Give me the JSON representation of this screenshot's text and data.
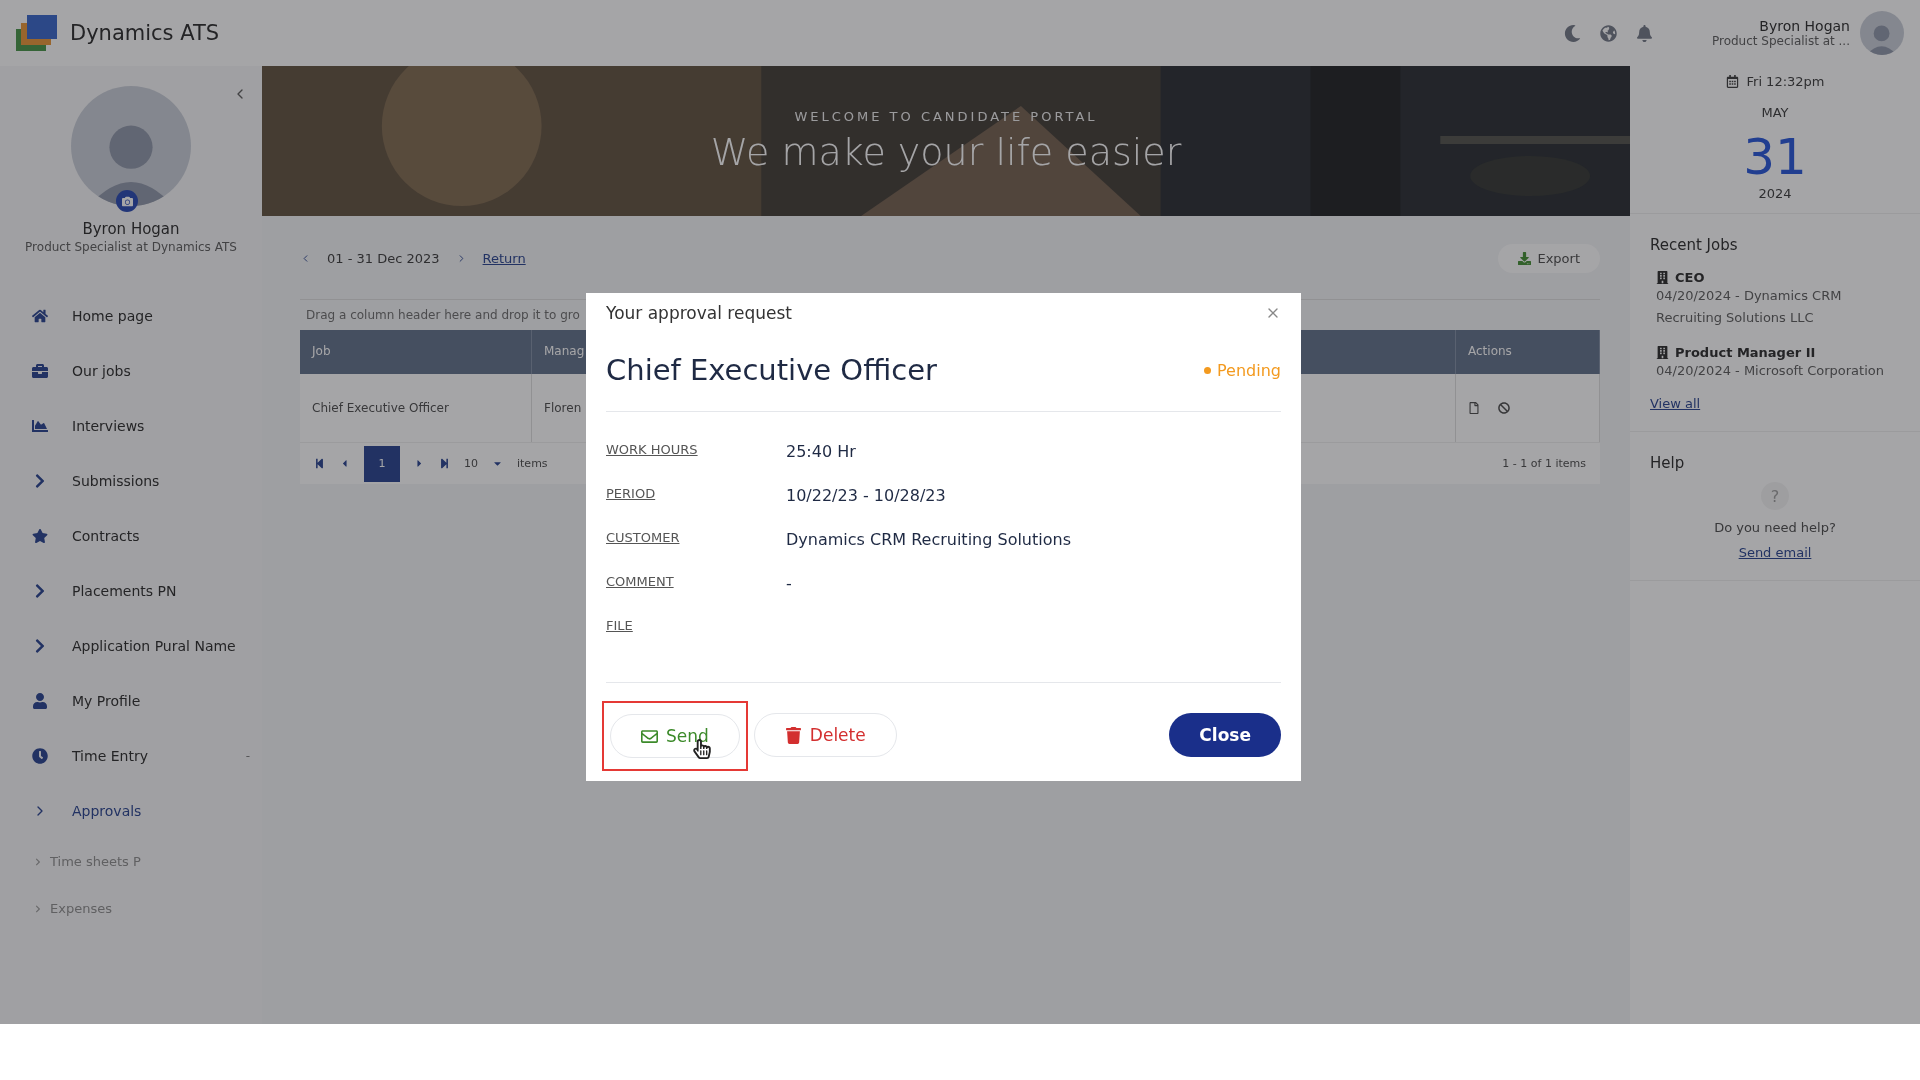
{
  "app": {
    "name": "Dynamics ATS"
  },
  "user": {
    "name": "Byron Hogan",
    "role_short": "Product Specialist at ..."
  },
  "profile": {
    "name": "Byron Hogan",
    "role": "Product Specialist at Dynamics ATS"
  },
  "nav": [
    {
      "label": "Home page",
      "kind": "home",
      "selected": false
    },
    {
      "label": "Our jobs",
      "kind": "jobs",
      "selected": false
    },
    {
      "label": "Interviews",
      "kind": "interviews",
      "selected": false
    },
    {
      "label": "Submissions",
      "kind": "group",
      "selected": false
    },
    {
      "label": "Contracts",
      "kind": "contracts",
      "selected": false
    },
    {
      "label": "Placements PN",
      "kind": "group",
      "selected": false
    },
    {
      "label": "Application Pural Name",
      "kind": "group",
      "selected": false
    },
    {
      "label": "My Profile",
      "kind": "profile",
      "selected": false
    },
    {
      "label": "Time Entry",
      "kind": "time",
      "selected": false,
      "trailing": "-"
    },
    {
      "label": "Approvals",
      "kind": "folder",
      "selected": true,
      "expanded": true,
      "children": [
        {
          "label": "Time sheets P"
        },
        {
          "label": "Expenses"
        }
      ]
    }
  ],
  "banner": {
    "kicker": "WELCOME TO CANDIDATE PORTAL",
    "headline": "We make your life easier"
  },
  "toolbar": {
    "range": "01 - 31 Dec 2023",
    "link": "Return",
    "export": "Export"
  },
  "grid": {
    "group_hint": "Drag a column header here and drop it to gro",
    "columns": [
      "Job",
      "Manag",
      "Actions"
    ],
    "rows": [
      [
        "Chief Executive Officer",
        "Floren"
      ]
    ],
    "pager": {
      "page": "1",
      "size": "10",
      "size_label": "items",
      "summary": "1 - 1 of 1 items"
    }
  },
  "clock": {
    "time": "Fri 12:32pm",
    "month": "MAY",
    "day": "31",
    "year": "2024"
  },
  "recent_jobs": {
    "title": "Recent Jobs",
    "items": [
      {
        "title": "CEO",
        "detail": "04/20/2024 - Dynamics CRM Recruiting Solutions LLC"
      },
      {
        "title": "Product Manager II",
        "detail": "04/20/2024 - Microsoft Corporation"
      }
    ],
    "link": "View all"
  },
  "help": {
    "title": "Help",
    "icon": "?",
    "question": "Do you need help?",
    "link": "Send email"
  },
  "modal": {
    "title": "Your approval request",
    "heading": "Chief Executive Officer",
    "status": "Pending",
    "fields": [
      {
        "label": "WORK HOURS",
        "value": "25:40 Hr"
      },
      {
        "label": "PERIOD",
        "value": "10/22/23 - 10/28/23"
      },
      {
        "label": "CUSTOMER",
        "value": "Dynamics CRM Recruiting Solutions"
      },
      {
        "label": "COMMENT",
        "value": "-"
      },
      {
        "label": "FILE"
      }
    ],
    "buttons": [
      {
        "label": "Send",
        "kind": "send",
        "highlighted": true
      },
      {
        "label": "Delete",
        "kind": "delete",
        "highlighted": false
      },
      {
        "label": "Close",
        "kind": "close",
        "highlighted": false
      }
    ]
  }
}
